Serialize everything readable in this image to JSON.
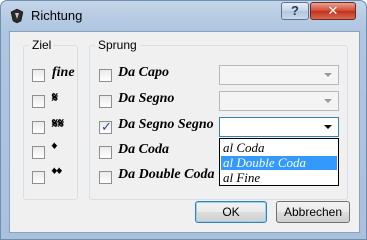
{
  "window": {
    "title": "Richtung",
    "help_label": "?",
    "close_label": "✕"
  },
  "ziel": {
    "legend": "Ziel",
    "items": [
      {
        "label": "fine",
        "checked": false
      },
      {
        "label": "𝄋",
        "checked": false
      },
      {
        "label": "𝄋𝄋",
        "checked": false
      },
      {
        "label": "𝄌",
        "checked": false
      },
      {
        "label": "𝄌𝄌",
        "checked": false
      }
    ]
  },
  "sprung": {
    "legend": "Sprung",
    "items": [
      {
        "label": "Da Capo",
        "checked": false
      },
      {
        "label": "Da Segno",
        "checked": false
      },
      {
        "label": "Da Segno Segno",
        "checked": true
      },
      {
        "label": "Da Coda",
        "checked": false
      },
      {
        "label": "Da Double Coda",
        "checked": false
      }
    ],
    "combo_values": [
      "",
      "",
      ""
    ],
    "dropdown_options": [
      "al Coda",
      "al Double Coda",
      "al Fine"
    ],
    "dropdown_selected_index": 1
  },
  "buttons": {
    "ok": "OK",
    "cancel": "Abbrechen"
  },
  "colors": {
    "selection": "#3399ff",
    "focus_border": "#3c7fb1",
    "close_button": "#c0321c"
  }
}
